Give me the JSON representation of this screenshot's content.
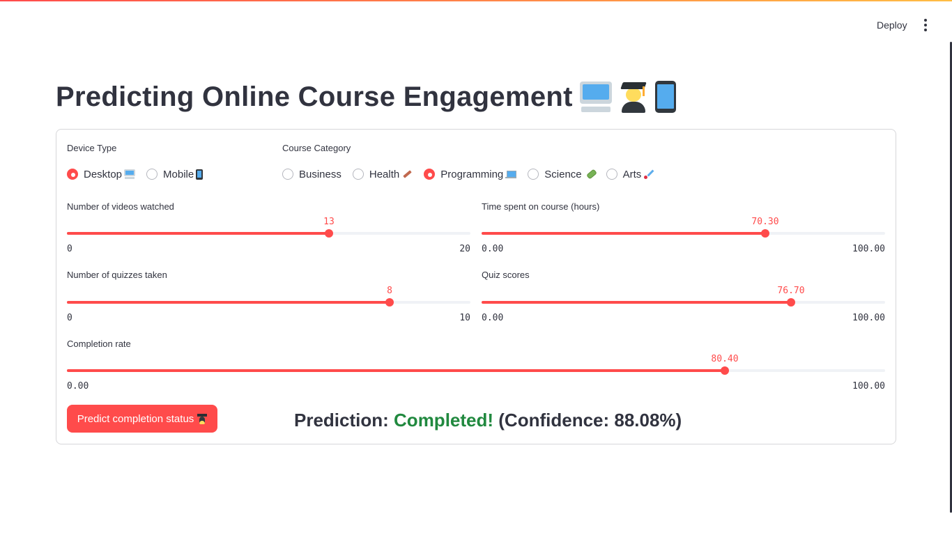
{
  "header": {
    "deploy_label": "Deploy",
    "menu_icon": "kebab-menu-icon"
  },
  "page_title": "Predicting Online Course Engagement",
  "title_emojis": [
    "desktop-computer-icon",
    "student-icon",
    "mobile-phone-icon"
  ],
  "device_type": {
    "label": "Device Type",
    "options": [
      {
        "label": "Desktop",
        "icon": "desktop-computer-icon",
        "selected": true
      },
      {
        "label": "Mobile",
        "icon": "mobile-phone-icon",
        "selected": false
      }
    ]
  },
  "course_category": {
    "label": "Course Category",
    "options": [
      {
        "label": "Business",
        "icon": "",
        "selected": false
      },
      {
        "label": "Health",
        "icon": "syringe-icon",
        "selected": false
      },
      {
        "label": "Programming",
        "icon": "laptop-icon",
        "selected": true
      },
      {
        "label": "Science",
        "icon": "test-tube-icon",
        "selected": false
      },
      {
        "label": "Arts",
        "icon": "paintbrush-icon",
        "selected": false
      }
    ]
  },
  "sliders": {
    "videos": {
      "label": "Number of videos watched",
      "value": 13,
      "value_text": "13",
      "min": 0,
      "max": 20,
      "min_text": "0",
      "max_text": "20"
    },
    "time": {
      "label": "Time spent on course (hours)",
      "value": 70.3,
      "value_text": "70.30",
      "min": 0,
      "max": 100,
      "min_text": "0.00",
      "max_text": "100.00"
    },
    "quizzes": {
      "label": "Number of quizzes taken",
      "value": 8,
      "value_text": "8",
      "min": 0,
      "max": 10,
      "min_text": "0",
      "max_text": "10"
    },
    "scores": {
      "label": "Quiz scores",
      "value": 76.7,
      "value_text": "76.70",
      "min": 0,
      "max": 100,
      "min_text": "0.00",
      "max_text": "100.00"
    },
    "completion": {
      "label": "Completion rate",
      "value": 80.4,
      "value_text": "80.40",
      "min": 0,
      "max": 100,
      "min_text": "0.00",
      "max_text": "100.00"
    }
  },
  "predict_button": {
    "label": "Predict completion status",
    "icon": "student-icon"
  },
  "prediction": {
    "prefix": "Prediction:",
    "result": "Completed!",
    "confidence": "(Confidence: 88.08%)"
  },
  "colors": {
    "accent": "#ff4b4b",
    "success": "#21893f",
    "text": "#31333f"
  }
}
